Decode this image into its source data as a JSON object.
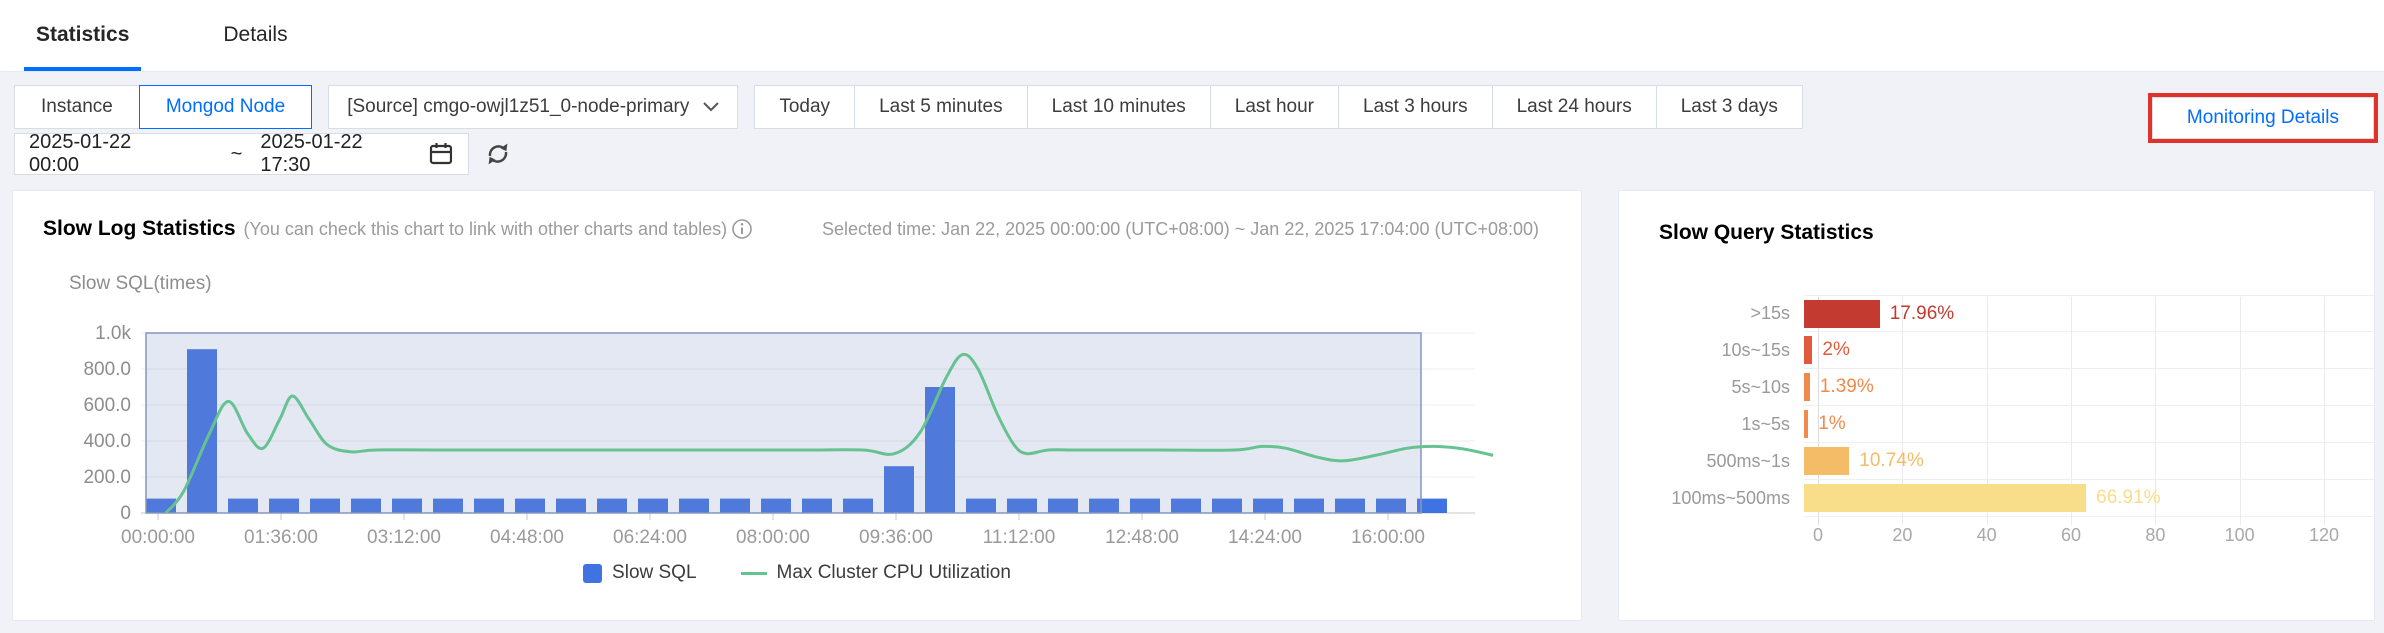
{
  "colors": {
    "accent": "#006eff",
    "bar_blue": "#4073e2",
    "line_green": "#67c291",
    "highlight_red": "#e0332a",
    "selection_fill": "rgba(133,150,196,0.22)",
    "selection_border": "#8596c2"
  },
  "tabs": {
    "statistics": "Statistics",
    "details": "Details"
  },
  "filters": {
    "scope": {
      "instance": "Instance",
      "mongod_node": "Mongod Node"
    },
    "source_dropdown": "[Source] cmgo-owjl1z51_0-node-primary",
    "ranges": [
      "Today",
      "Last 5 minutes",
      "Last 10 minutes",
      "Last hour",
      "Last 3 hours",
      "Last 24 hours",
      "Last 3 days"
    ],
    "date_start": "2025-01-22 00:00",
    "date_separator": "~",
    "date_end": "2025-01-22 17:30",
    "monitoring_details": "Monitoring Details"
  },
  "slow_log_panel": {
    "title": "Slow Log Statistics",
    "note": "(You can check this chart to link with other charts and tables)",
    "selected_time": "Selected time: Jan 22, 2025 00:00:00 (UTC+08:00) ~ Jan 22, 2025 17:04:00 (UTC+08:00)",
    "y_axis_label": "Slow SQL(times)"
  },
  "slow_query_panel": {
    "title": "Slow Query Statistics"
  },
  "chart_data": [
    {
      "type": "bar+line",
      "title": "Slow Log Statistics",
      "ylabel": "Slow SQL(times)",
      "ylim": [
        0,
        1000
      ],
      "y_ticks": [
        "0",
        "200.0",
        "400.0",
        "600.0",
        "800.0",
        "1.0k"
      ],
      "x_ticks": [
        "00:00:00",
        "01:36:00",
        "03:12:00",
        "04:48:00",
        "06:24:00",
        "08:00:00",
        "09:36:00",
        "11:12:00",
        "12:48:00",
        "14:24:00",
        "16:00:00"
      ],
      "x_tick_interval_minutes": 96,
      "selection_window": "00:00:00 ~ 17:04:00",
      "series": [
        {
          "name": "Slow SQL",
          "kind": "bar",
          "color": "#4073e2",
          "unit": "times",
          "interval_minutes": 32,
          "times": [
            "00:00",
            "00:32",
            "01:04",
            "01:36",
            "02:08",
            "02:40",
            "03:12",
            "03:44",
            "04:16",
            "04:48",
            "05:20",
            "05:52",
            "06:24",
            "06:56",
            "07:28",
            "08:00",
            "08:32",
            "09:04",
            "09:36",
            "10:08",
            "10:40",
            "11:12",
            "11:44",
            "12:16",
            "12:48",
            "13:20",
            "13:52",
            "14:24",
            "14:56",
            "15:28",
            "16:00",
            "16:32"
          ],
          "values": [
            80,
            910,
            80,
            80,
            80,
            80,
            80,
            80,
            80,
            80,
            80,
            80,
            80,
            80,
            80,
            80,
            80,
            80,
            260,
            700,
            80,
            80,
            80,
            80,
            80,
            80,
            80,
            80,
            80,
            80,
            80,
            80
          ]
        },
        {
          "name": "Max Cluster CPU Utilization",
          "kind": "line",
          "color": "#67c291",
          "unit": "%",
          "points_t_minutes_pct": [
            [
              6,
              0
            ],
            [
              20,
              12
            ],
            [
              40,
              44
            ],
            [
              55,
              62
            ],
            [
              70,
              44
            ],
            [
              82,
              36
            ],
            [
              95,
              52
            ],
            [
              105,
              65
            ],
            [
              118,
              52
            ],
            [
              132,
              38
            ],
            [
              150,
              34
            ],
            [
              170,
              35
            ],
            [
              220,
              35
            ],
            [
              300,
              35
            ],
            [
              400,
              35
            ],
            [
              500,
              35
            ],
            [
              550,
              35
            ],
            [
              575,
              33
            ],
            [
              595,
              45
            ],
            [
              615,
              75
            ],
            [
              628,
              88
            ],
            [
              640,
              80
            ],
            [
              655,
              55
            ],
            [
              668,
              38
            ],
            [
              678,
              33
            ],
            [
              695,
              35
            ],
            [
              720,
              35
            ],
            [
              780,
              35
            ],
            [
              840,
              35
            ],
            [
              862,
              37
            ],
            [
              880,
              36
            ],
            [
              905,
              31
            ],
            [
              925,
              29
            ],
            [
              950,
              32
            ],
            [
              975,
              36
            ],
            [
              995,
              37
            ],
            [
              1015,
              36
            ],
            [
              1030,
              34
            ],
            [
              1042,
              32
            ]
          ]
        }
      ],
      "legend": [
        {
          "label": "Slow SQL",
          "swatch": "square",
          "color": "#4073e2"
        },
        {
          "label": "Max Cluster CPU Utilization",
          "swatch": "line",
          "color": "#67c291"
        }
      ],
      "legend_position": "bottom-center"
    },
    {
      "type": "bar",
      "orientation": "horizontal",
      "title": "Slow Query Statistics",
      "categories": [
        ">15s",
        "10s~15s",
        "5s~10s",
        "1s~5s",
        "500ms~1s",
        "100ms~500ms"
      ],
      "values": [
        17.96,
        2,
        1.39,
        1,
        10.74,
        66.91
      ],
      "value_labels": [
        "17.96%",
        "2%",
        "1.39%",
        "1%",
        "10.74%",
        "66.91%"
      ],
      "bar_colors": [
        "#c23a30",
        "#e25a3c",
        "#ef8a4b",
        "#ef8a4b",
        "#f5bc68",
        "#f8dd8b"
      ],
      "xlim": [
        0,
        120
      ],
      "x_ticks": [
        0,
        20,
        40,
        60,
        80,
        100,
        120
      ],
      "grid": "vertical"
    }
  ]
}
